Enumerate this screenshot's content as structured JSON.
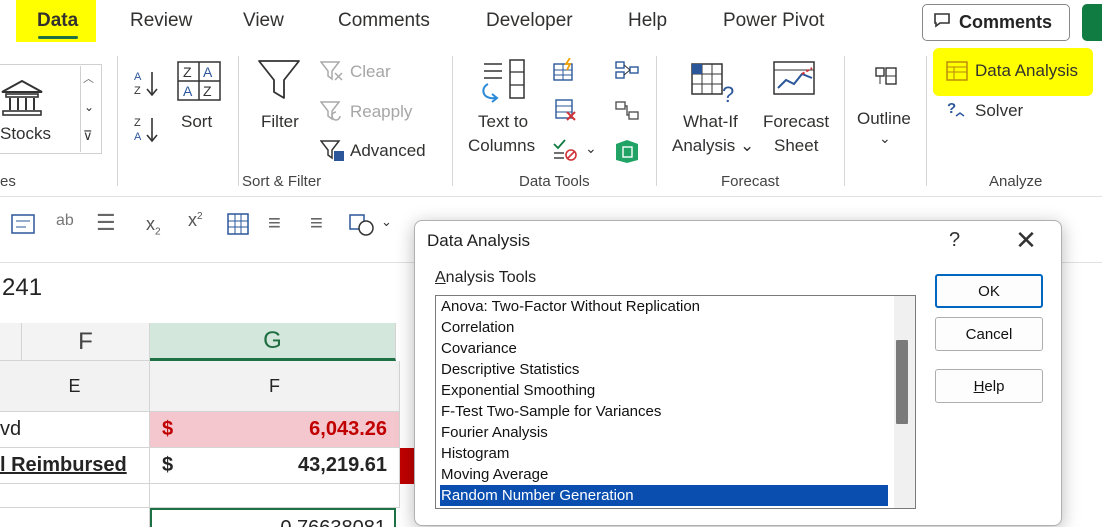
{
  "tabs": [
    {
      "label": "Data",
      "active": true
    },
    {
      "label": "Review"
    },
    {
      "label": "View"
    },
    {
      "label": "Comments"
    },
    {
      "label": "Developer"
    },
    {
      "label": "Help"
    },
    {
      "label": "Power Pivot"
    }
  ],
  "comments_button": "Comments",
  "ribbon": {
    "stocks": "Stocks",
    "sort_label": "Sort",
    "filter_label": "Filter",
    "clear_label": "Clear",
    "reapply_label": "Reapply",
    "advanced_label": "Advanced",
    "text_to_columns_line1": "Text to",
    "text_to_columns_line2": "Columns",
    "whatif_line1": "What-If",
    "whatif_line2": "Analysis ⌄",
    "forecast_line1": "Forecast",
    "forecast_line2": "Sheet",
    "outline_label": "Outline",
    "data_analysis_label": "Data Analysis",
    "solver_label": "Solver",
    "groups": {
      "left_partial": "es",
      "sort_filter": "Sort & Filter",
      "data_tools": "Data Tools",
      "forecast": "Forecast",
      "analyze": "Analyze"
    }
  },
  "formula_bar": {
    "cell_ref_partial": "241"
  },
  "grid": {
    "col_headers": [
      "F",
      "G"
    ],
    "row1": {
      "e": "E",
      "f": "F"
    },
    "row2": {
      "e": "vd",
      "dollar": "$",
      "f": "6,043.26"
    },
    "row3": {
      "e": "l Reimbursed",
      "dollar": "$",
      "f": "43,219.61"
    },
    "row5": {
      "f": "0.76638081"
    }
  },
  "dialog": {
    "title": "Data Analysis",
    "help_q": "?",
    "close": "✕",
    "list_label_prefix": "A",
    "list_label_rest": "nalysis Tools",
    "items": [
      "Anova: Two-Factor Without Replication",
      "Correlation",
      "Covariance",
      "Descriptive Statistics",
      "Exponential Smoothing",
      "F-Test Two-Sample for Variances",
      "Fourier Analysis",
      "Histogram",
      "Moving Average",
      "Random Number Generation"
    ],
    "selected_index": 9,
    "ok": "OK",
    "cancel": "Cancel",
    "help_prefix": "H",
    "help_rest": "elp"
  },
  "colors": {
    "excel_green": "#1e7145",
    "highlight_yellow": "#ffff00",
    "selection_blue": "#0a4fb0",
    "negative_red": "#c00000",
    "pink_fill": "#f4c7ce"
  }
}
